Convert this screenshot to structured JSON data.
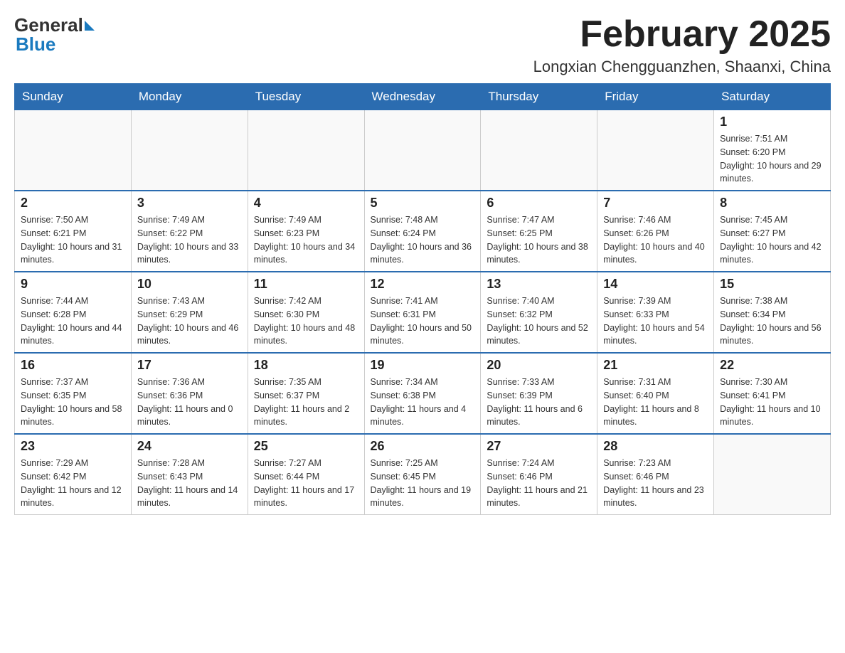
{
  "logo": {
    "general": "General",
    "blue": "Blue"
  },
  "title": "February 2025",
  "location": "Longxian Chengguanzhen, Shaanxi, China",
  "days_of_week": [
    "Sunday",
    "Monday",
    "Tuesday",
    "Wednesday",
    "Thursday",
    "Friday",
    "Saturday"
  ],
  "weeks": [
    [
      {
        "day": "",
        "info": ""
      },
      {
        "day": "",
        "info": ""
      },
      {
        "day": "",
        "info": ""
      },
      {
        "day": "",
        "info": ""
      },
      {
        "day": "",
        "info": ""
      },
      {
        "day": "",
        "info": ""
      },
      {
        "day": "1",
        "info": "Sunrise: 7:51 AM\nSunset: 6:20 PM\nDaylight: 10 hours and 29 minutes."
      }
    ],
    [
      {
        "day": "2",
        "info": "Sunrise: 7:50 AM\nSunset: 6:21 PM\nDaylight: 10 hours and 31 minutes."
      },
      {
        "day": "3",
        "info": "Sunrise: 7:49 AM\nSunset: 6:22 PM\nDaylight: 10 hours and 33 minutes."
      },
      {
        "day": "4",
        "info": "Sunrise: 7:49 AM\nSunset: 6:23 PM\nDaylight: 10 hours and 34 minutes."
      },
      {
        "day": "5",
        "info": "Sunrise: 7:48 AM\nSunset: 6:24 PM\nDaylight: 10 hours and 36 minutes."
      },
      {
        "day": "6",
        "info": "Sunrise: 7:47 AM\nSunset: 6:25 PM\nDaylight: 10 hours and 38 minutes."
      },
      {
        "day": "7",
        "info": "Sunrise: 7:46 AM\nSunset: 6:26 PM\nDaylight: 10 hours and 40 minutes."
      },
      {
        "day": "8",
        "info": "Sunrise: 7:45 AM\nSunset: 6:27 PM\nDaylight: 10 hours and 42 minutes."
      }
    ],
    [
      {
        "day": "9",
        "info": "Sunrise: 7:44 AM\nSunset: 6:28 PM\nDaylight: 10 hours and 44 minutes."
      },
      {
        "day": "10",
        "info": "Sunrise: 7:43 AM\nSunset: 6:29 PM\nDaylight: 10 hours and 46 minutes."
      },
      {
        "day": "11",
        "info": "Sunrise: 7:42 AM\nSunset: 6:30 PM\nDaylight: 10 hours and 48 minutes."
      },
      {
        "day": "12",
        "info": "Sunrise: 7:41 AM\nSunset: 6:31 PM\nDaylight: 10 hours and 50 minutes."
      },
      {
        "day": "13",
        "info": "Sunrise: 7:40 AM\nSunset: 6:32 PM\nDaylight: 10 hours and 52 minutes."
      },
      {
        "day": "14",
        "info": "Sunrise: 7:39 AM\nSunset: 6:33 PM\nDaylight: 10 hours and 54 minutes."
      },
      {
        "day": "15",
        "info": "Sunrise: 7:38 AM\nSunset: 6:34 PM\nDaylight: 10 hours and 56 minutes."
      }
    ],
    [
      {
        "day": "16",
        "info": "Sunrise: 7:37 AM\nSunset: 6:35 PM\nDaylight: 10 hours and 58 minutes."
      },
      {
        "day": "17",
        "info": "Sunrise: 7:36 AM\nSunset: 6:36 PM\nDaylight: 11 hours and 0 minutes."
      },
      {
        "day": "18",
        "info": "Sunrise: 7:35 AM\nSunset: 6:37 PM\nDaylight: 11 hours and 2 minutes."
      },
      {
        "day": "19",
        "info": "Sunrise: 7:34 AM\nSunset: 6:38 PM\nDaylight: 11 hours and 4 minutes."
      },
      {
        "day": "20",
        "info": "Sunrise: 7:33 AM\nSunset: 6:39 PM\nDaylight: 11 hours and 6 minutes."
      },
      {
        "day": "21",
        "info": "Sunrise: 7:31 AM\nSunset: 6:40 PM\nDaylight: 11 hours and 8 minutes."
      },
      {
        "day": "22",
        "info": "Sunrise: 7:30 AM\nSunset: 6:41 PM\nDaylight: 11 hours and 10 minutes."
      }
    ],
    [
      {
        "day": "23",
        "info": "Sunrise: 7:29 AM\nSunset: 6:42 PM\nDaylight: 11 hours and 12 minutes."
      },
      {
        "day": "24",
        "info": "Sunrise: 7:28 AM\nSunset: 6:43 PM\nDaylight: 11 hours and 14 minutes."
      },
      {
        "day": "25",
        "info": "Sunrise: 7:27 AM\nSunset: 6:44 PM\nDaylight: 11 hours and 17 minutes."
      },
      {
        "day": "26",
        "info": "Sunrise: 7:25 AM\nSunset: 6:45 PM\nDaylight: 11 hours and 19 minutes."
      },
      {
        "day": "27",
        "info": "Sunrise: 7:24 AM\nSunset: 6:46 PM\nDaylight: 11 hours and 21 minutes."
      },
      {
        "day": "28",
        "info": "Sunrise: 7:23 AM\nSunset: 6:46 PM\nDaylight: 11 hours and 23 minutes."
      },
      {
        "day": "",
        "info": ""
      }
    ]
  ]
}
